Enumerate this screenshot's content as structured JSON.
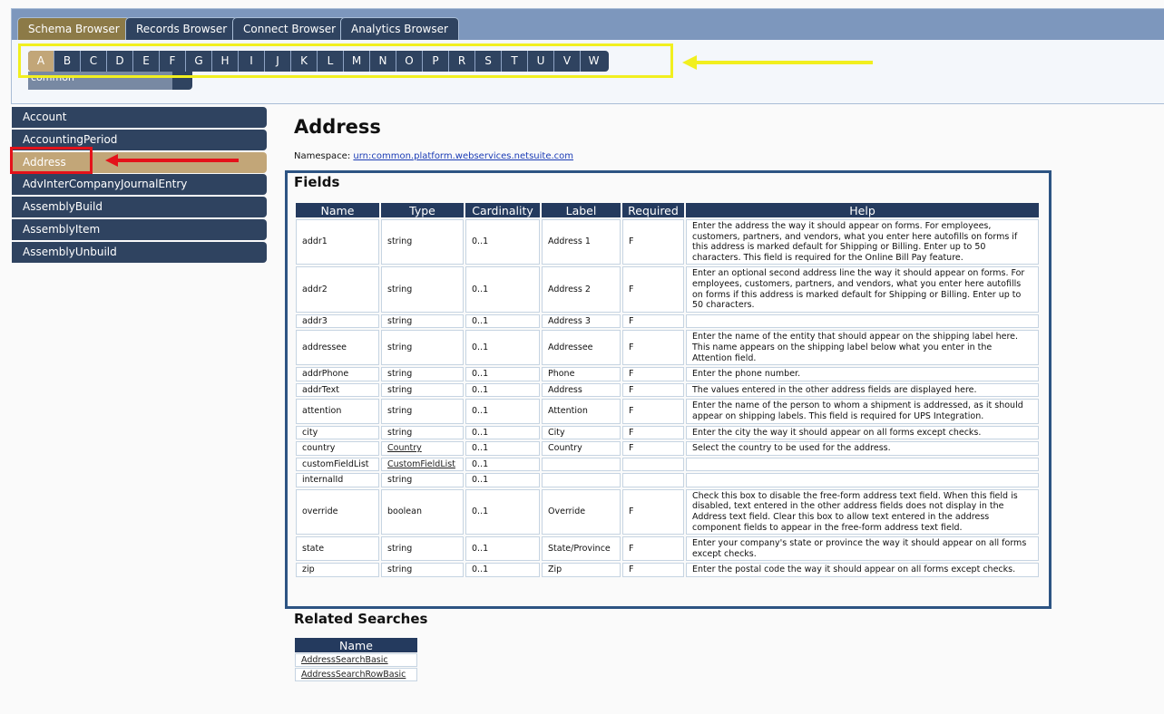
{
  "tabs": [
    "Schema Browser",
    "Records Browser",
    "Connect Browser",
    "Analytics Browser"
  ],
  "active_tab": "Schema Browser",
  "letters": [
    "A",
    "B",
    "C",
    "D",
    "E",
    "F",
    "G",
    "H",
    "I",
    "J",
    "K",
    "L",
    "M",
    "N",
    "O",
    "P",
    "R",
    "S",
    "T",
    "U",
    "V",
    "W"
  ],
  "active_letter": "A",
  "namespace_selector": "common",
  "sidebar": [
    "Account",
    "AccountingPeriod",
    "Address",
    "AdvInterCompanyJournalEntry",
    "AssemblyBuild",
    "AssemblyItem",
    "AssemblyUnbuild"
  ],
  "sidebar_active": "Address",
  "main": {
    "title": "Address",
    "namespace_label": "Namespace:",
    "namespace_value": "urn:common.platform.webservices.netsuite.com",
    "fields_heading": "Fields",
    "columns": [
      "Name",
      "Type",
      "Cardinality",
      "Label",
      "Required",
      "Help"
    ],
    "rows": [
      {
        "name": "addr1",
        "type": "string",
        "card": "0..1",
        "label": "Address 1",
        "req": "F",
        "help": "Enter the address the way it should appear on forms. For employees, customers, partners, and vendors, what you enter here autofills on forms if this address is marked default for Shipping or Billing. Enter up to 50 characters. This field is required for the Online Bill Pay feature."
      },
      {
        "name": "addr2",
        "type": "string",
        "card": "0..1",
        "label": "Address 2",
        "req": "F",
        "help": "Enter an optional second address line the way it should appear on forms. For employees, customers, partners, and vendors, what you enter here autofills on forms if this address is marked default for Shipping or Billing. Enter up to 50 characters."
      },
      {
        "name": "addr3",
        "type": "string",
        "card": "0..1",
        "label": "Address 3",
        "req": "F",
        "help": ""
      },
      {
        "name": "addressee",
        "type": "string",
        "card": "0..1",
        "label": "Addressee",
        "req": "F",
        "help": "Enter the name of the entity that should appear on the shipping label here. This name appears on the shipping label below what you enter in the Attention field."
      },
      {
        "name": "addrPhone",
        "type": "string",
        "card": "0..1",
        "label": "Phone",
        "req": "F",
        "help": "Enter the phone number."
      },
      {
        "name": "addrText",
        "type": "string",
        "card": "0..1",
        "label": "Address",
        "req": "F",
        "help": "The values entered in the other address fields are displayed here."
      },
      {
        "name": "attention",
        "type": "string",
        "card": "0..1",
        "label": "Attention",
        "req": "F",
        "help": "Enter the name of the person to whom a shipment is addressed, as it should appear on shipping labels. This field is required for UPS Integration."
      },
      {
        "name": "city",
        "type": "string",
        "card": "0..1",
        "label": "City",
        "req": "F",
        "help": "Enter the city the way it should appear on all forms except checks."
      },
      {
        "name": "country",
        "type": "Country",
        "type_link": true,
        "card": "0..1",
        "label": "Country",
        "req": "F",
        "help": "Select the country to be used for the address."
      },
      {
        "name": "customFieldList",
        "type": "CustomFieldList",
        "type_link": true,
        "card": "0..1",
        "label": "",
        "req": "",
        "help": ""
      },
      {
        "name": "internalId",
        "type": "string",
        "card": "0..1",
        "label": "",
        "req": "",
        "help": ""
      },
      {
        "name": "override",
        "type": "boolean",
        "card": "0..1",
        "label": "Override",
        "req": "F",
        "help": "Check this box to disable the free-form address text field. When this field is disabled, text entered in the other address fields does not display in the Address text field. Clear this box to allow text entered in the address component fields to appear in the free-form address text field."
      },
      {
        "name": "state",
        "type": "string",
        "card": "0..1",
        "label": "State/Province",
        "req": "F",
        "help": "Enter your company's state or province the way it should appear on all forms except checks."
      },
      {
        "name": "zip",
        "type": "string",
        "card": "0..1",
        "label": "Zip",
        "req": "F",
        "help": "Enter the postal code the way it should appear on all forms except checks."
      }
    ],
    "related_heading": "Related Searches",
    "related_column": "Name",
    "related": [
      "AddressSearchBasic",
      "AddressSearchRowBasic"
    ]
  },
  "colors": {
    "navy": "#2f4360",
    "gold_active": "#8c7a47",
    "tan_active": "#c2a678",
    "highlight_yellow": "#f1ef1f",
    "highlight_red": "#e4121a",
    "fields_border": "#2d5483"
  }
}
